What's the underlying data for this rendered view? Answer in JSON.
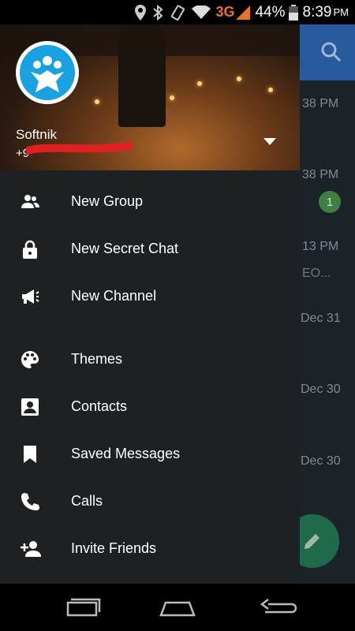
{
  "status_bar": {
    "network": "3G",
    "battery": "44%",
    "time": "8:39",
    "ampm": "PM"
  },
  "drawer": {
    "user": {
      "name": "Softnik",
      "phone_prefix": "+9"
    },
    "menu": [
      {
        "label": "New Group",
        "icon": "group-icon"
      },
      {
        "label": "New Secret Chat",
        "icon": "lock-icon"
      },
      {
        "label": "New Channel",
        "icon": "megaphone-icon"
      },
      {
        "label": "Themes",
        "icon": "palette-icon"
      },
      {
        "label": "Contacts",
        "icon": "contact-icon"
      },
      {
        "label": "Saved Messages",
        "icon": "bookmark-icon"
      },
      {
        "label": "Calls",
        "icon": "phone-icon"
      },
      {
        "label": "Invite Friends",
        "icon": "add-person-icon"
      }
    ]
  },
  "chat_list_bg": {
    "timestamps": [
      "38 PM",
      "38 PM",
      "13 PM",
      "Dec 31",
      "Dec 30",
      "Dec 30"
    ],
    "unread_count": "1",
    "preview_text": "EO..."
  },
  "colors": {
    "drawer_bg": "#1e2124",
    "header_blue": "#2a5a9e",
    "fab_green": "#1e6a4a",
    "avatar_blue": "#1aa1e2",
    "network_orange": "#e8712a"
  }
}
